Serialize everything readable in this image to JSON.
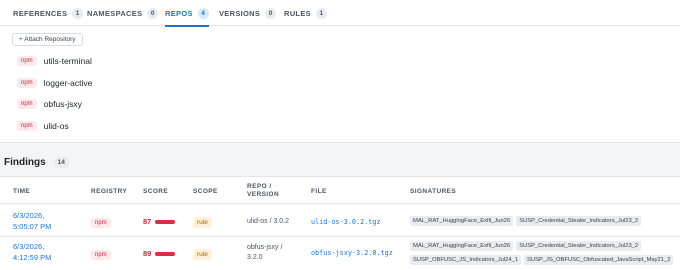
{
  "tabs": [
    {
      "label": "REFERENCES",
      "count": "1"
    },
    {
      "label": "NAMESPACES",
      "count": "0"
    },
    {
      "label": "REPOS",
      "count": "4"
    },
    {
      "label": "VERSIONS",
      "count": "0"
    },
    {
      "label": "RULES",
      "count": "1"
    }
  ],
  "active_tab": "REPOS",
  "attach_button": "+ Attach Repository",
  "repos": [
    {
      "ecosystem": "npm",
      "name": "utils-terminal"
    },
    {
      "ecosystem": "npm",
      "name": "logger-active"
    },
    {
      "ecosystem": "npm",
      "name": "obfus-jsxy"
    },
    {
      "ecosystem": "npm",
      "name": "ulid-os"
    }
  ],
  "findings": {
    "title": "Findings",
    "count": "14",
    "columns": [
      "TIME",
      "REGISTRY",
      "SCORE",
      "SCOPE",
      "REPO /\nVERSION",
      "FILE",
      "SIGNATURES"
    ],
    "rows": [
      {
        "time_line1": "6/3/2026,",
        "time_line2": "5:05:07 PM",
        "registry": "npm",
        "score": "87",
        "scope": "rule",
        "repo_line1": "ulid-os / 3.0.2",
        "repo_line2": "",
        "file": "ulid-os-3.0.2.tgz",
        "signatures": [
          "MAL_RAT_HuggingFace_Exfil_Jun26",
          "SUSP_Credential_Stealer_Indicators_Jul23_2"
        ]
      },
      {
        "time_line1": "6/3/2026,",
        "time_line2": "4:12:59 PM",
        "registry": "npm",
        "score": "89",
        "scope": "rule",
        "repo_line1": "obfus-jsxy /",
        "repo_line2": "3.2.0",
        "file": "obfus-jsxy-3.2.0.tgz",
        "signatures": [
          "MAL_RAT_HuggingFace_Exfil_Jun26",
          "SUSP_Credential_Stealer_Indicators_Jul23_2",
          "SUSP_OBFUSC_JS_Indicators_Jul24_1",
          "SUSP_JS_OBFUSC_Obfuscated_JavaScript_May21_2"
        ]
      }
    ]
  },
  "colors": {
    "accent": "#1f74c9",
    "danger": "#c8243d",
    "scope_bg": "#fdf0d9"
  }
}
